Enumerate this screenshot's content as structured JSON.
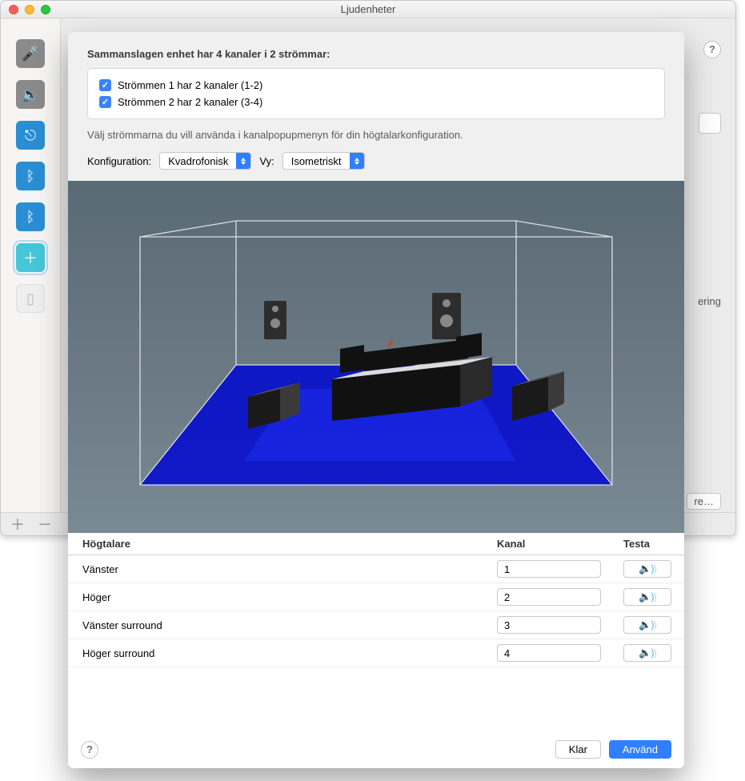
{
  "bg_window": {
    "title": "Ljudenheter",
    "partial_tag": "ering",
    "partial_btn": "re…"
  },
  "sheet": {
    "heading": "Sammanslagen enhet har 4 kanaler i 2 strömmar:",
    "streams": [
      {
        "checked": true,
        "label": "Strömmen 1 har 2 kanaler (1-2)"
      },
      {
        "checked": true,
        "label": "Strömmen 2 har 2 kanaler (3-4)"
      }
    ],
    "helper": "Välj strömmarna du vill använda i kanalpopupmenyn för din högtalarkonfiguration.",
    "config_label": "Konfiguration:",
    "config_value": "Kvadrofonisk",
    "view_label": "Vy:",
    "view_value": "Isometriskt"
  },
  "table": {
    "col_speaker": "Högtalare",
    "col_channel": "Kanal",
    "col_test": "Testa",
    "rows": [
      {
        "name": "Vänster",
        "channel": "1"
      },
      {
        "name": "Höger",
        "channel": "2"
      },
      {
        "name": "Vänster surround",
        "channel": "3"
      },
      {
        "name": "Höger surround",
        "channel": "4"
      }
    ]
  },
  "footer": {
    "done": "Klar",
    "apply": "Använd"
  }
}
